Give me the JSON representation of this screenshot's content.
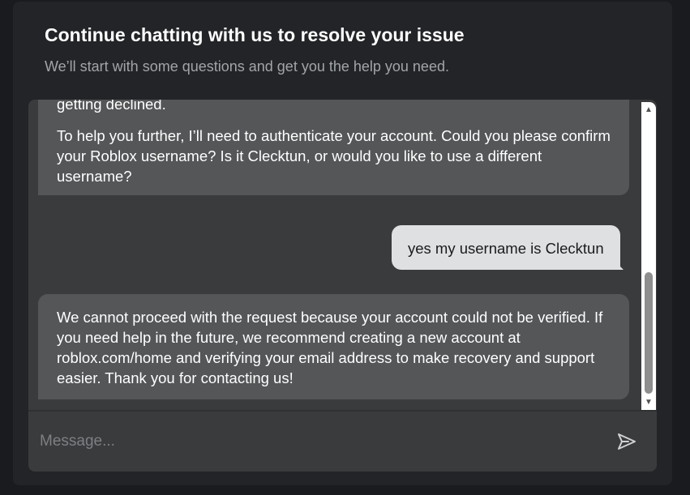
{
  "header": {
    "title": "Continue chatting with us to resolve your issue",
    "subtitle": "We’ll start with some questions and get you the help you need."
  },
  "messages": [
    {
      "sender": "agent",
      "paragraphs": [
        "getting declined.",
        "To help you further, I’ll need to authenticate your account. Could you please confirm your Roblox username? Is it Clecktun, or would you like to use a different username?"
      ]
    },
    {
      "sender": "user",
      "text": "yes my username is Clecktun"
    },
    {
      "sender": "agent",
      "text": "We cannot proceed with the request because your account could not be verified. If you need help in the future, we recommend creating a new account at roblox.com/home and verifying your email address to make recovery and support easier. Thank you for contacting us!"
    }
  ],
  "scrollbar": {
    "up_icon": "▲",
    "down_icon": "▼"
  },
  "composer": {
    "placeholder": "Message...",
    "value": "",
    "send_icon": "send-icon"
  },
  "colors": {
    "page_bg": "#1a1b1e",
    "dialog_bg": "#232427",
    "panel_bg": "#393b3d",
    "agent_bubble": "#545658",
    "user_bubble": "#dfe0e2",
    "subtitle": "#a2a4a8",
    "placeholder": "#7d7f82"
  }
}
